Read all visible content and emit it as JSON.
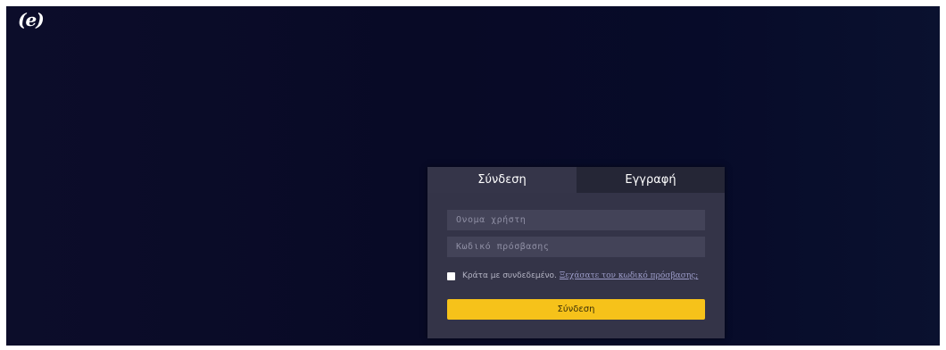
{
  "logo": {
    "text": "(e)"
  },
  "tabs": [
    {
      "label": "Σύνδεση",
      "active": true
    },
    {
      "label": "Εγγραφή",
      "active": false
    }
  ],
  "login_form": {
    "username_placeholder": "Ονομα χρήστη",
    "username_value": "",
    "password_placeholder": "Κωδικό πρόσβασης",
    "password_value": "",
    "remember_label": "Κράτα με συνδεδεμένο.",
    "remember_checked": false,
    "forgot_link": "Ξεχάσατε τον κωδικό πρόσβασης;",
    "submit_label": "Σύνδεση"
  },
  "colors": {
    "background": "#080a26",
    "card": "#343448",
    "inactive_tab": "#252636",
    "input": "#434358",
    "accent_button": "#f6c21a"
  }
}
